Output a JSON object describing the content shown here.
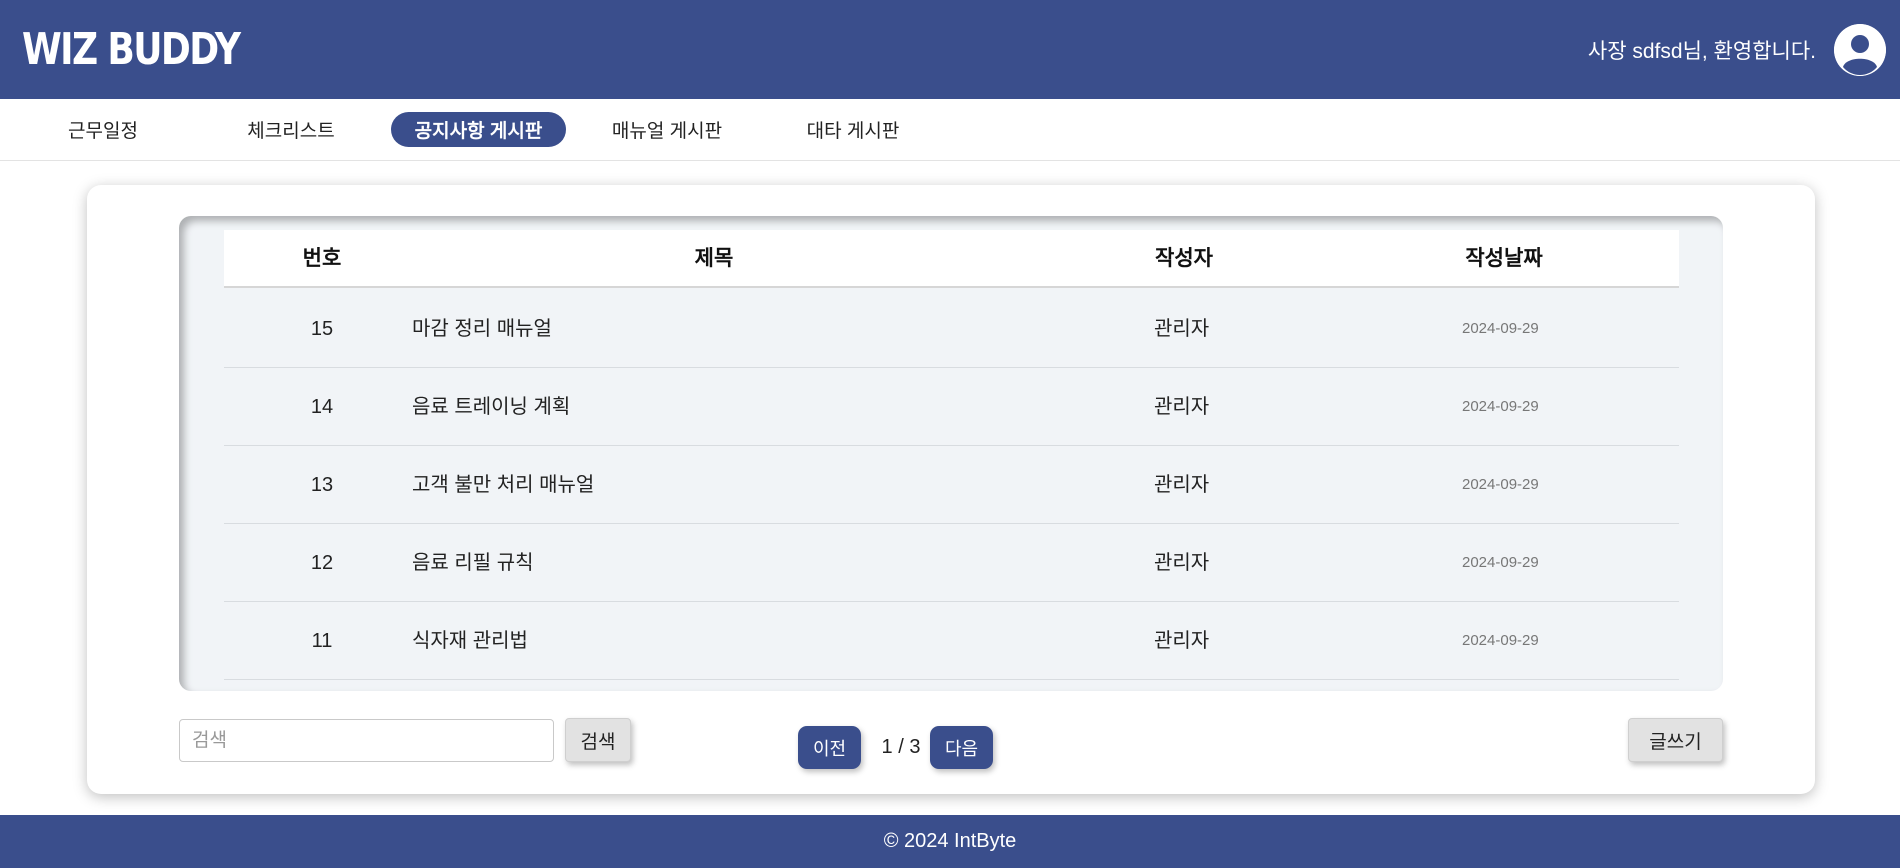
{
  "header": {
    "logo": "WIZ BUDDY",
    "welcome": "사장 sdfsd님, 환영합니다."
  },
  "nav": {
    "items": [
      {
        "label": "근무일정"
      },
      {
        "label": "체크리스트"
      },
      {
        "label": "공지사항 게시판",
        "active": true
      },
      {
        "label": "매뉴얼 게시판"
      },
      {
        "label": "대타 게시판"
      }
    ]
  },
  "table": {
    "columns": [
      "번호",
      "제목",
      "작성자",
      "작성날짜"
    ],
    "rows": [
      {
        "num": "15",
        "title": "마감 정리 매뉴얼",
        "author": "관리자",
        "date": "2024-09-29"
      },
      {
        "num": "14",
        "title": "음료 트레이닝 계획",
        "author": "관리자",
        "date": "2024-09-29"
      },
      {
        "num": "13",
        "title": "고객 불만 처리 매뉴얼",
        "author": "관리자",
        "date": "2024-09-29"
      },
      {
        "num": "12",
        "title": "음료 리필 규칙",
        "author": "관리자",
        "date": "2024-09-29"
      },
      {
        "num": "11",
        "title": "식자재 관리법",
        "author": "관리자",
        "date": "2024-09-29"
      }
    ]
  },
  "search": {
    "placeholder": "검색",
    "button": "검색"
  },
  "pagination": {
    "prev": "이전",
    "info": "1 / 3",
    "next": "다음"
  },
  "write_button": "글쓰기",
  "footer": "© 2024 IntByte",
  "colors": {
    "brand": "#3a4e8c",
    "table_bg": "#f1f4f7"
  }
}
